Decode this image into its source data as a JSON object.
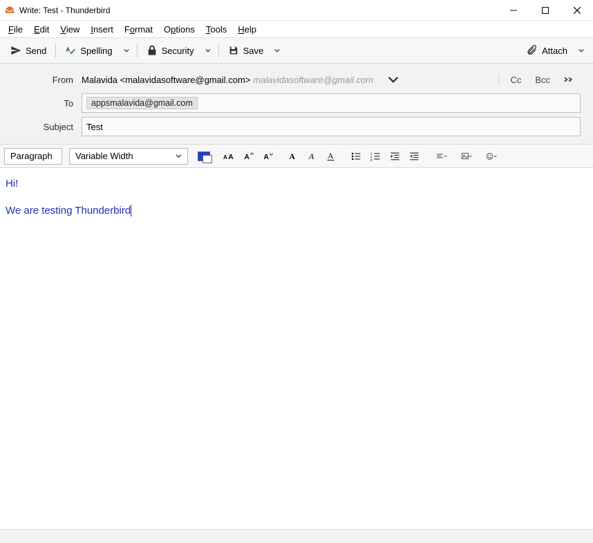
{
  "window": {
    "title": "Write: Test - Thunderbird"
  },
  "menu": {
    "file": "File",
    "edit": "Edit",
    "view": "View",
    "insert": "Insert",
    "format": "Format",
    "options": "Options",
    "tools": "Tools",
    "help": "Help"
  },
  "toolbar": {
    "send": "Send",
    "spelling": "Spelling",
    "security": "Security",
    "save": "Save",
    "attach": "Attach"
  },
  "header": {
    "from_label": "From",
    "from_value": "Malavida <malavidasoftware@gmail.com>",
    "from_faded": "malavidasoftware@gmail.com",
    "to_label": "To",
    "to_value": "appsmalavida@gmail.com",
    "subject_label": "Subject",
    "subject_value": "Test",
    "cc": "Cc",
    "bcc": "Bcc"
  },
  "format": {
    "block": "Paragraph",
    "font": "Variable Width"
  },
  "body": {
    "line1": "Hi!",
    "line2": "We are testing Thunderbird"
  }
}
